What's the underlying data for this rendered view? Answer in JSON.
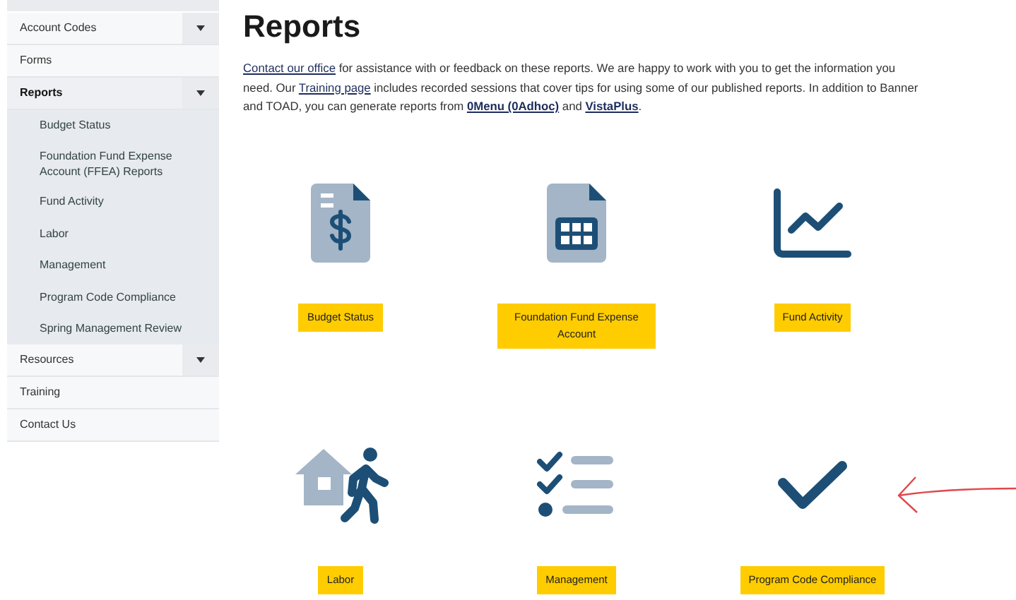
{
  "sidebar": {
    "items": [
      {
        "label": "Account Codes",
        "kind": "top",
        "expandable": true,
        "selected": false
      },
      {
        "label": "Forms",
        "kind": "top",
        "expandable": false,
        "selected": false
      },
      {
        "label": "Reports",
        "kind": "top",
        "expandable": true,
        "selected": true
      },
      {
        "label": "Budget Status",
        "kind": "sub",
        "expandable": false,
        "selected": false
      },
      {
        "label": "Foundation Fund Expense Account (FFEA) Reports",
        "kind": "sub",
        "expandable": false,
        "selected": false
      },
      {
        "label": "Fund Activity",
        "kind": "sub",
        "expandable": false,
        "selected": false
      },
      {
        "label": "Labor",
        "kind": "sub",
        "expandable": false,
        "selected": false
      },
      {
        "label": "Management",
        "kind": "sub",
        "expandable": false,
        "selected": false
      },
      {
        "label": "Program Code Compliance",
        "kind": "sub",
        "expandable": false,
        "selected": false
      },
      {
        "label": "Spring Management Review",
        "kind": "sub",
        "expandable": false,
        "selected": false
      },
      {
        "label": "Resources",
        "kind": "top",
        "expandable": true,
        "selected": false
      },
      {
        "label": "Training",
        "kind": "top",
        "expandable": false,
        "selected": false
      },
      {
        "label": "Contact Us",
        "kind": "top",
        "expandable": false,
        "selected": false
      }
    ]
  },
  "page": {
    "title": "Reports",
    "intro": [
      {
        "text": "Contact our office",
        "kind": "link"
      },
      {
        "text": " for assistance with or feedback on these reports. We are happy to work with you to get the information you need. Our ",
        "kind": "plain"
      },
      {
        "text": "Training page",
        "kind": "link"
      },
      {
        "text": " includes recorded sessions that cover tips for using some of our published reports. In addition to Banner and TOAD, you can generate reports from ",
        "kind": "plain"
      },
      {
        "text": "0Menu (0Adhoc)",
        "kind": "bold-link"
      },
      {
        "text": " and ",
        "kind": "plain"
      },
      {
        "text": "VistaPlus",
        "kind": "bold-link"
      },
      {
        "text": ".",
        "kind": "plain"
      }
    ],
    "tiles": [
      {
        "label": "Budget Status",
        "kind": "invoice"
      },
      {
        "label": "Foundation Fund Expense Account",
        "kind": "spreadsheet"
      },
      {
        "label": "Fund Activity",
        "kind": "chart"
      },
      {
        "label": "Labor",
        "kind": "worker"
      },
      {
        "label": "Management",
        "kind": "checklist"
      },
      {
        "label": "Program Code Compliance",
        "kind": "check"
      }
    ]
  }
}
